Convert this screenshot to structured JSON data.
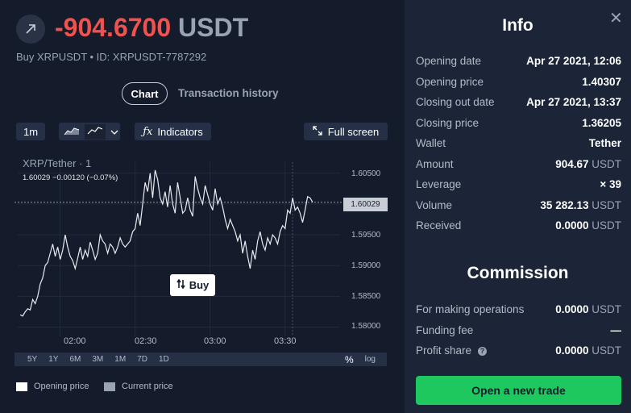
{
  "trade": {
    "pnl_value": "-904.6700",
    "pnl_currency": "USDT",
    "subtitle": "Buy XRPUSDT • ID: XRPUSDT-7787292"
  },
  "tabs": {
    "chart": "Chart",
    "history": "Transaction history"
  },
  "toolbar": {
    "interval": "1m",
    "indicators": "Indicators",
    "fullscreen": "Full screen"
  },
  "chart_data": {
    "type": "line",
    "pair": "XRP/Tether · 1",
    "ohlc_text": "1.60029  −0.00120 (−0.07%)",
    "current_price_label": "1.60029",
    "current_price": 1.60029,
    "y_ticks": [
      "1.60500",
      "1.60000",
      "1.59500",
      "1.59000",
      "1.58500",
      "1.58000"
    ],
    "y_tick_values": [
      1.605,
      1.6,
      1.595,
      1.59,
      1.585,
      1.58
    ],
    "ylim": [
      1.5785,
      1.6068
    ],
    "x_ticks": [
      "02:00",
      "02:30",
      "03:00",
      "03:30"
    ],
    "x_tick_values": [
      120,
      150,
      180,
      210
    ],
    "xlim": [
      103,
      232
    ],
    "series": [
      {
        "values": [
          [
            104,
            1.582
          ],
          [
            105,
            1.5818
          ],
          [
            106,
            1.5825
          ],
          [
            107,
            1.583
          ],
          [
            108,
            1.5828
          ],
          [
            109,
            1.5845
          ],
          [
            110,
            1.5838
          ],
          [
            111,
            1.585
          ],
          [
            112,
            1.587
          ],
          [
            113,
            1.588
          ],
          [
            114,
            1.59
          ],
          [
            115,
            1.5905
          ],
          [
            116,
            1.592
          ],
          [
            117,
            1.5935
          ],
          [
            118,
            1.5915
          ],
          [
            119,
            1.593
          ],
          [
            120,
            1.591
          ],
          [
            121,
            1.5925
          ],
          [
            122,
            1.595
          ],
          [
            123,
            1.593
          ],
          [
            124,
            1.5915
          ],
          [
            125,
            1.5908
          ],
          [
            126,
            1.5895
          ],
          [
            127,
            1.5912
          ],
          [
            128,
            1.593
          ],
          [
            129,
            1.591
          ],
          [
            130,
            1.5925
          ],
          [
            131,
            1.5915
          ],
          [
            132,
            1.5938
          ],
          [
            133,
            1.5925
          ],
          [
            134,
            1.591
          ],
          [
            135,
            1.592
          ],
          [
            136,
            1.595
          ],
          [
            137,
            1.594
          ],
          [
            138,
            1.5935
          ],
          [
            139,
            1.592
          ],
          [
            140,
            1.5935
          ],
          [
            141,
            1.593
          ],
          [
            142,
            1.592
          ],
          [
            143,
            1.593
          ],
          [
            144,
            1.5945
          ],
          [
            145,
            1.5935
          ],
          [
            146,
            1.593
          ],
          [
            147,
            1.5935
          ],
          [
            148,
            1.594
          ],
          [
            149,
            1.5955
          ],
          [
            150,
            1.596
          ],
          [
            151,
            1.5985
          ],
          [
            152,
            1.5965
          ],
          [
            153,
            1.6
          ],
          [
            154,
            1.6035
          ],
          [
            155,
            1.602
          ],
          [
            156,
            1.605
          ],
          [
            157,
            1.601
          ],
          [
            158,
            1.6055
          ],
          [
            159,
            1.604
          ],
          [
            160,
            1.601
          ],
          [
            161,
            1.6
          ],
          [
            162,
            1.602
          ],
          [
            163,
            1.5995
          ],
          [
            164,
            1.603
          ],
          [
            165,
            1.6
          ],
          [
            166,
            1.5985
          ],
          [
            167,
            1.6035
          ],
          [
            168,
            1.601
          ],
          [
            169,
            1.5985
          ],
          [
            170,
            1.599
          ],
          [
            171,
            1.601
          ],
          [
            172,
            1.599
          ],
          [
            173,
            1.598
          ],
          [
            174,
            1.6045
          ],
          [
            175,
            1.6025
          ],
          [
            176,
            1.601
          ],
          [
            177,
            1.6
          ],
          [
            178,
            1.603
          ],
          [
            179,
            1.6015
          ],
          [
            180,
            1.6
          ],
          [
            181,
            1.599
          ],
          [
            182,
            1.6025
          ],
          [
            183,
            1.6
          ],
          [
            184,
            1.601
          ],
          [
            185,
            1.5995
          ],
          [
            186,
            1.5975
          ],
          [
            187,
            1.596
          ],
          [
            188,
            1.5975
          ],
          [
            189,
            1.5965
          ],
          [
            190,
            1.5955
          ],
          [
            191,
            1.594
          ],
          [
            192,
            1.595
          ],
          [
            193,
            1.592
          ],
          [
            194,
            1.594
          ],
          [
            195,
            1.5915
          ],
          [
            196,
            1.5895
          ],
          [
            197,
            1.5925
          ],
          [
            198,
            1.591
          ],
          [
            199,
            1.594
          ],
          [
            200,
            1.5955
          ],
          [
            201,
            1.5935
          ],
          [
            202,
            1.5925
          ],
          [
            203,
            1.5945
          ],
          [
            204,
            1.5935
          ],
          [
            205,
            1.595
          ],
          [
            206,
            1.5945
          ],
          [
            207,
            1.5935
          ],
          [
            208,
            1.5955
          ],
          [
            209,
            1.5965
          ],
          [
            210,
            1.596
          ],
          [
            211,
            1.599
          ],
          [
            212,
            1.5985
          ],
          [
            213,
            1.601
          ],
          [
            214,
            1.599
          ],
          [
            215,
            1.5995
          ],
          [
            216,
            1.5985
          ],
          [
            217,
            1.597
          ],
          [
            218,
            1.599
          ],
          [
            219,
            1.6012
          ],
          [
            220,
            1.601
          ],
          [
            221,
            1.6003
          ]
        ]
      }
    ],
    "grid": true
  },
  "buy_marker": "Buy",
  "ranges": [
    "5Y",
    "1Y",
    "6M",
    "3M",
    "1M",
    "7D",
    "1D"
  ],
  "scale_modes": {
    "percent": "%",
    "log": "log"
  },
  "legend": {
    "opening": "Opening price",
    "current": "Current price",
    "opening_color": "#ffffff",
    "current_color": "#9aa3b3"
  },
  "info": {
    "title": "Info",
    "rows": [
      {
        "key": "Opening date",
        "value": "Apr 27 2021, 12:06",
        "unit": ""
      },
      {
        "key": "Opening price",
        "value": "1.40307",
        "unit": ""
      },
      {
        "key": "Closing out date",
        "value": "Apr 27 2021, 13:37",
        "unit": ""
      },
      {
        "key": "Closing price",
        "value": "1.36205",
        "unit": ""
      },
      {
        "key": "Wallet",
        "value": "Tether",
        "unit": ""
      },
      {
        "key": "Amount",
        "value": "904.67",
        "unit": "USDT"
      },
      {
        "key": "Leverage",
        "value": "× 39",
        "unit": ""
      },
      {
        "key": "Volume",
        "value": "35 282.13",
        "unit": "USDT"
      },
      {
        "key": "Received",
        "value": "0.0000",
        "unit": "USDT"
      }
    ]
  },
  "commission": {
    "title": "Commission",
    "rows": [
      {
        "key": "For making operations",
        "value": "0.0000",
        "unit": "USDT"
      },
      {
        "key": "Funding fee",
        "value": "—",
        "unit": ""
      },
      {
        "key": "Profit share",
        "value": "0.0000",
        "unit": "USDT"
      }
    ]
  },
  "cta": {
    "open_trade": "Open a new trade"
  },
  "colors": {
    "loss": "#f0524f",
    "cta": "#1ec85e",
    "panel": "#1c2537",
    "background": "#141b2a"
  }
}
